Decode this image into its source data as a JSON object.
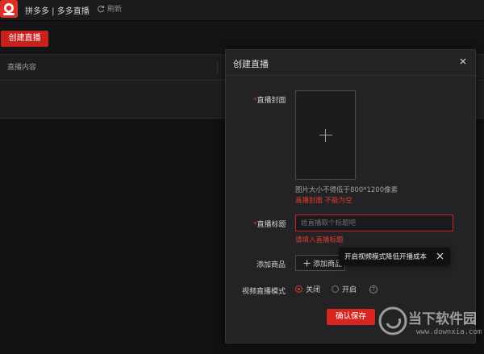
{
  "app": {
    "title": "拼多多 | 多多直播",
    "refresh_label": "刷新"
  },
  "toolbar": {
    "create_label": "创建直播"
  },
  "table": {
    "columns": [
      "直播内容"
    ]
  },
  "modal": {
    "title": "创建直播",
    "cover": {
      "label": "直播封面",
      "hint": "图片大小不得低于800*1200像素",
      "error": "直播封面 不能为空"
    },
    "live_title": {
      "label": "直播标题",
      "placeholder": "给直播取个标题吧",
      "value": "",
      "error": "请填入直播标题"
    },
    "goods": {
      "label": "添加商品",
      "button_label": "添加商品"
    },
    "tooltip": {
      "text": "开启视频模式降低开播成本"
    },
    "video_mode": {
      "label": "视频直播模式",
      "options": [
        "关闭",
        "开启"
      ],
      "selected": "关闭"
    },
    "save_label": "确认保存"
  },
  "watermark": {
    "brand": "当下软件园",
    "url": "www.downxia.com"
  },
  "colors": {
    "accent": "#d8261f",
    "error": "#e23b30",
    "background": "#141416",
    "modal": "#232325"
  }
}
